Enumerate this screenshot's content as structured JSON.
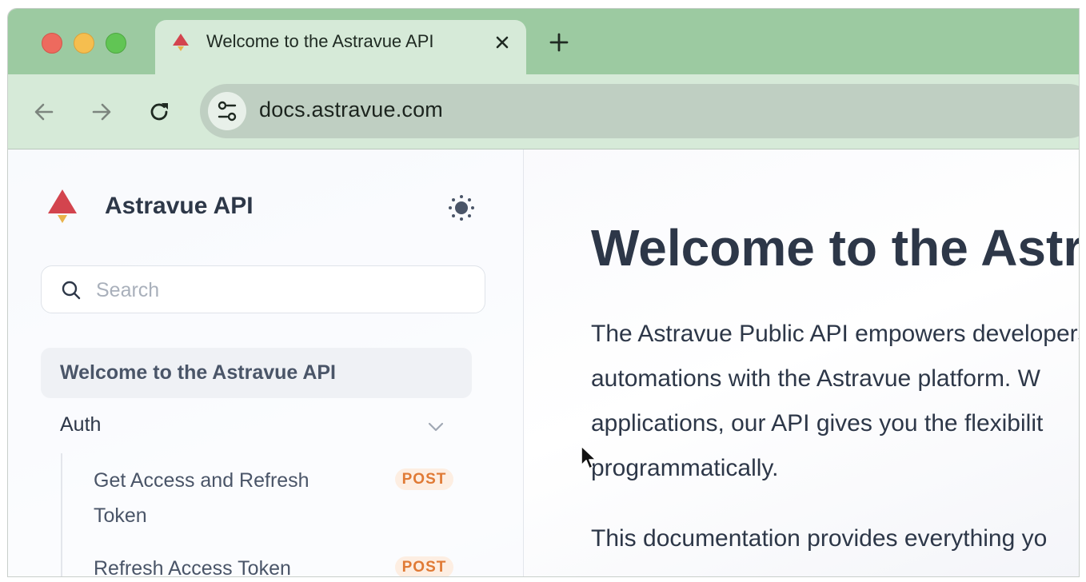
{
  "browser": {
    "tab": {
      "title": "Welcome to the Astravue API",
      "favicon": "astravue-logo-icon",
      "close_icon": "close-icon"
    },
    "new_tab_icon": "plus-icon",
    "nav": {
      "back_icon": "arrow-left-icon",
      "forward_icon": "arrow-right-icon",
      "reload_icon": "reload-icon"
    },
    "omnibox": {
      "site_info_icon": "tune-icon",
      "url": "docs.astravue.com"
    },
    "colors": {
      "tabstrip": "#9ccaa1",
      "toolbar": "#d6ead8",
      "omnibox": "#bfcfc2"
    }
  },
  "sidebar": {
    "brand_name": "Astravue API",
    "theme_toggle_icon": "sun-icon",
    "search": {
      "placeholder": "Search",
      "value": ""
    },
    "nav": {
      "active_item": "Welcome to the Astravue API",
      "groups": [
        {
          "label": "Auth",
          "expanded": true,
          "items": [
            {
              "label": "Get Access and Refresh Token",
              "method": "POST"
            },
            {
              "label": "Refresh Access Token",
              "method": "POST"
            }
          ]
        }
      ]
    },
    "badge_colors": {
      "POST_bg": "#fdeee2",
      "POST_text": "#e07a35"
    }
  },
  "main": {
    "title": "Welcome to the Astravue API",
    "paragraph1": [
      "The Astravue Public API empowers developers",
      "automations with the Astravue platform. W",
      "applications, our API gives you the flexibilit",
      "programmatically."
    ],
    "paragraph2": "This documentation provides everything yo"
  }
}
